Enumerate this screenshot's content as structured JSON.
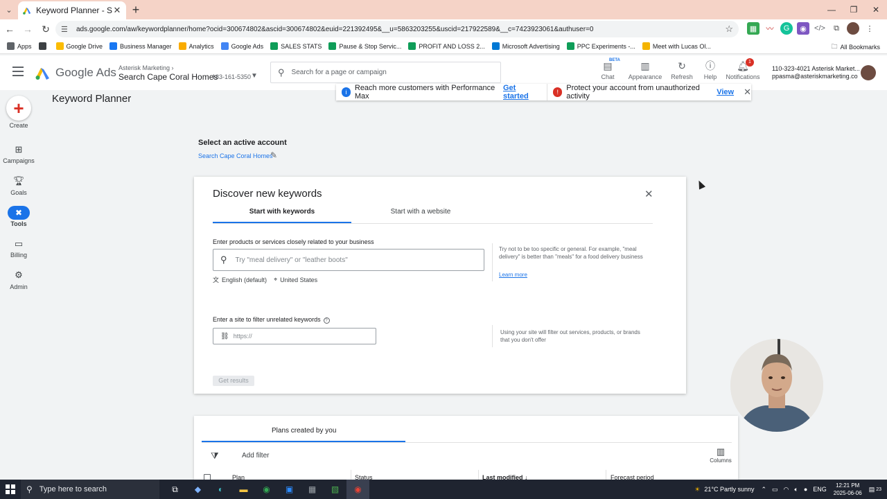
{
  "browser": {
    "tab_title": "Keyword Planner - Search Cape",
    "url": "ads.google.com/aw/keywordplanner/home?ocid=300674802&ascid=300674802&euid=221392495&__u=5863203255&uscid=217922589&__c=7423923061&authuser=0",
    "bookmarks": [
      "Apps",
      "Google Drive",
      "Business Manager",
      "Analytics",
      "Google Ads",
      "SALES STATS",
      "Pause & Stop Servic...",
      "PROFIT AND LOSS 2...",
      "Microsoft Advertising",
      "PPC Experiments -...",
      "Meet with Lucas Ol..."
    ],
    "all_bookmarks": "All Bookmarks"
  },
  "header": {
    "product": "Google Ads",
    "account_parent": "Asterisk Marketing",
    "account_name": "Search Cape Coral Homes",
    "account_id": "183-161-5350",
    "search_placeholder": "Search for a page or campaign",
    "tools": {
      "chat": "Chat",
      "chat_badge": "BETA",
      "appearance": "Appearance",
      "refresh": "Refresh",
      "help": "Help",
      "notifications": "Notifications",
      "notif_count": "1"
    },
    "user_line1": "110-323-4021 Asterisk Market...",
    "user_line2": "ppasma@asteriskmarketing.co"
  },
  "rail": {
    "create": "Create",
    "campaigns": "Campaigns",
    "goals": "Goals",
    "tools": "Tools",
    "billing": "Billing",
    "admin": "Admin"
  },
  "page": {
    "title": "Keyword Planner",
    "notice1": "Reach more customers with Performance Max",
    "notice1_link": "Get started",
    "notice2": "Protect your account from unauthorized activity",
    "notice2_link": "View",
    "select_title": "Select an active account",
    "select_link": "Search Cape Coral Homes"
  },
  "discover": {
    "title": "Discover new keywords",
    "tab_keywords": "Start with keywords",
    "tab_website": "Start with a website",
    "products_label": "Enter products or services closely related to your business",
    "products_placeholder": "Try \"meal delivery\" or \"leather boots\"",
    "language": "English (default)",
    "location": "United States",
    "hint1": "Try not to be too specific or general. For example, \"meal delivery\" is better than \"meals\" for a food delivery business",
    "learn_more": "Learn more",
    "site_label": "Enter a site to filter unrelated keywords",
    "site_placeholder": "https://",
    "hint2": "Using your site will filter out services, products, or brands that you don't offer",
    "get_results": "Get results"
  },
  "plans": {
    "tab": "Plans created by you",
    "add_filter": "Add filter",
    "columns": "Columns",
    "col_plan": "Plan",
    "col_status": "Status",
    "col_modified": "Last modified",
    "col_forecast": "Forecast period"
  },
  "taskbar": {
    "search": "Type here to search",
    "weather": "21°C  Partly sunny",
    "lang": "ENG",
    "time": "12:21 PM",
    "date": "2025-06-06",
    "notif": "23"
  },
  "colors": {
    "accent": "#1a73e8",
    "tab_strip": "#f5d3c7",
    "danger": "#d93025"
  }
}
